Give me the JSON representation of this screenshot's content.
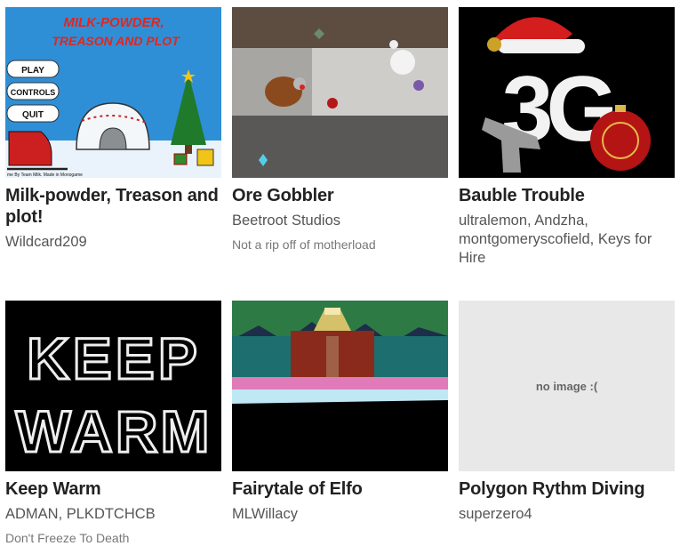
{
  "games": [
    {
      "title": "Milk-powder, Treason and plot!",
      "authors": "Wildcard209",
      "thumbnail": {
        "heading_line1": "MILK-POWDER,",
        "heading_line2": "TREASON AND PLOT",
        "menu": [
          "PLAY",
          "CONTROLS",
          "QUIT"
        ],
        "credit": "me By Team Milk. Made in Monogame"
      }
    },
    {
      "title": "Ore Gobbler",
      "authors": "Beetroot Studios",
      "tagline": "Not a rip off of motherload"
    },
    {
      "title": "Bauble Trouble",
      "authors": "ultralemon, Andzha, montgomeryscofield, Keys for Hire",
      "thumbnail": {
        "logo_text": "3G"
      }
    },
    {
      "title": "Keep Warm",
      "authors": "ADMAN, PLKDTCHCB",
      "tagline": "Don't Freeze To Death",
      "thumbnail": {
        "line1": "KEEP",
        "line2": "WARM"
      }
    },
    {
      "title": "Fairytale of Elfo",
      "authors": "MLWillacy"
    },
    {
      "title": "Polygon Rythm Diving",
      "authors": "superzero4",
      "thumbnail": {
        "placeholder_text": "no image :("
      }
    }
  ]
}
